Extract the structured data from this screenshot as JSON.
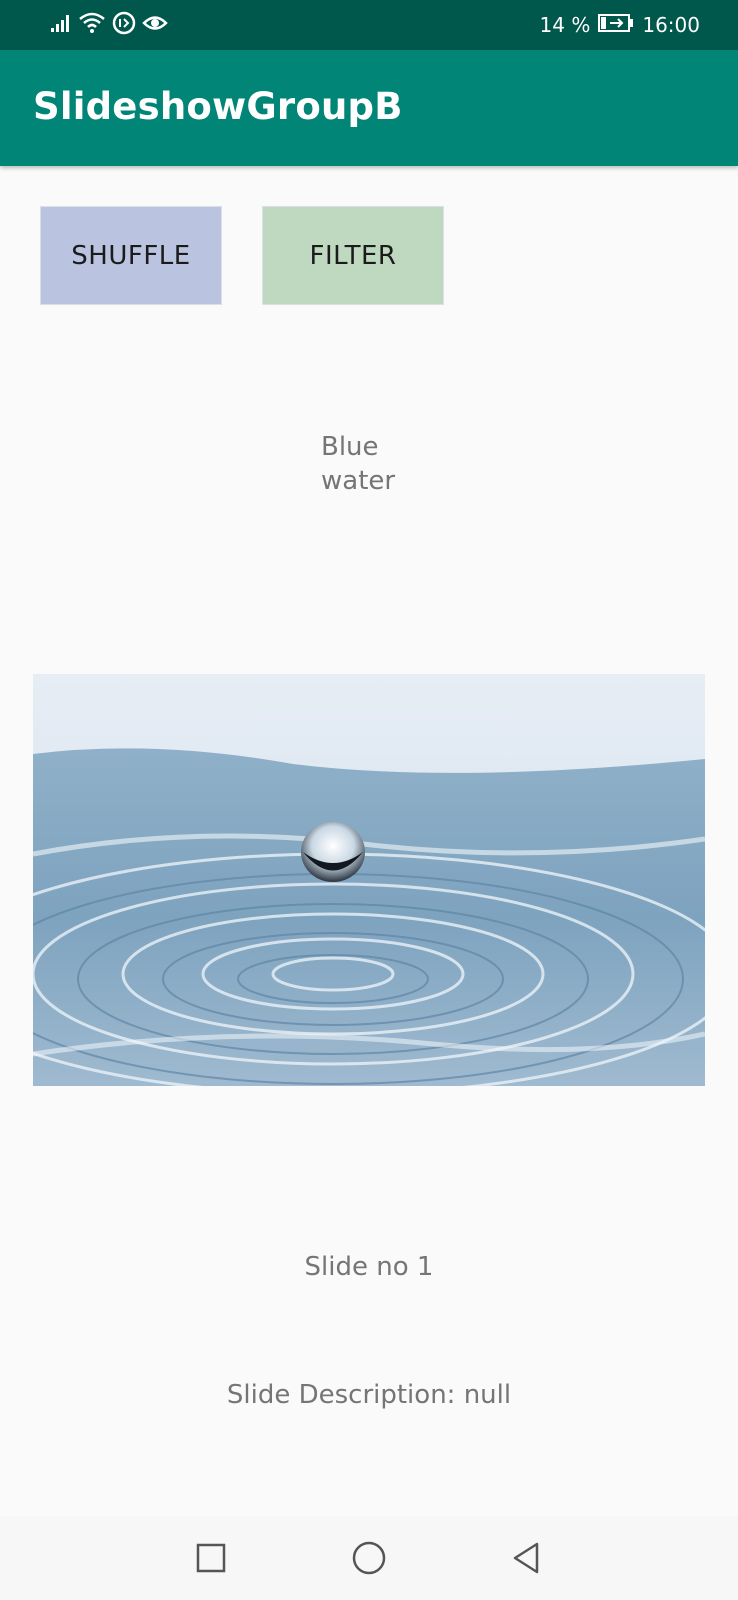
{
  "status_bar": {
    "battery_text": "14 %",
    "time": "16:00",
    "icons": [
      "signal-icon",
      "wifi-icon",
      "data-saver-icon",
      "eye-comfort-icon",
      "battery-charging-icon"
    ]
  },
  "app_bar": {
    "title": "SlideshowGroupB",
    "color": "#008577",
    "status_color": "#00574b"
  },
  "buttons": {
    "shuffle_label": "SHUFFLE",
    "shuffle_color": "#bac3e0",
    "filter_label": "FILTER",
    "filter_color": "#bed9bf"
  },
  "slide": {
    "title": "Blue water",
    "image_subject": "water drop ripple",
    "number_text": "Slide no 1",
    "description_text": "Slide Description: null"
  },
  "nav_bar": {
    "buttons": [
      "recents-square-icon",
      "home-circle-icon",
      "back-triangle-icon"
    ]
  }
}
